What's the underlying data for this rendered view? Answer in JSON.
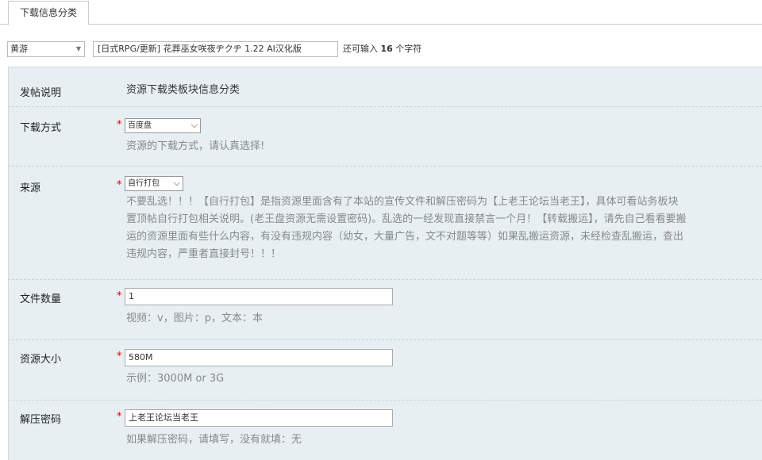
{
  "tab": {
    "label": "下载信息分类"
  },
  "post": {
    "category": "黄游",
    "title": "[日式RPG/更新] 花葬巫女咲夜ヂクヂ 1.22 AI汉化版",
    "counter_prefix": "还可输入",
    "counter_value": "16",
    "counter_suffix": "个字符"
  },
  "form": {
    "intro": {
      "label": "发帖说明",
      "text": "资源下载类板块信息分类"
    },
    "download_method": {
      "label": "下载方式",
      "required": "*",
      "value": "百度盘",
      "help": "资源的下载方式，请认真选择!"
    },
    "source": {
      "label": "来源",
      "required": "*",
      "value": "自行打包",
      "help_lines": [
        "不要乱选！！！【自行打包】是指资源里面含有了本站的宣传文件和解压密码为【上老王论坛当老王】，具体可看站务板块",
        "置顶帖自行打包相关说明。(老王盘资源无需设置密码)。乱选的一经发现直接禁言一个月！【转载搬运】，请先自己看看要搬",
        "运的资源里面有些什么内容，有没有违规内容（幼女，大量广告，文不对题等等）如果乱搬运资源，未经检查乱搬运，查出",
        "违规内容，严重者直接封号！！！"
      ]
    },
    "file_count": {
      "label": "文件数量",
      "required": "*",
      "value": "1",
      "help": "视频：v，图片：p，文本：本"
    },
    "size": {
      "label": "资源大小",
      "required": "*",
      "value": "580M",
      "help": "示例：3000M or 3G"
    },
    "password": {
      "label": "解压密码",
      "required": "*",
      "value": "上老王论坛当老王",
      "help": "如果解压密码，请填写，没有就填：无"
    }
  }
}
